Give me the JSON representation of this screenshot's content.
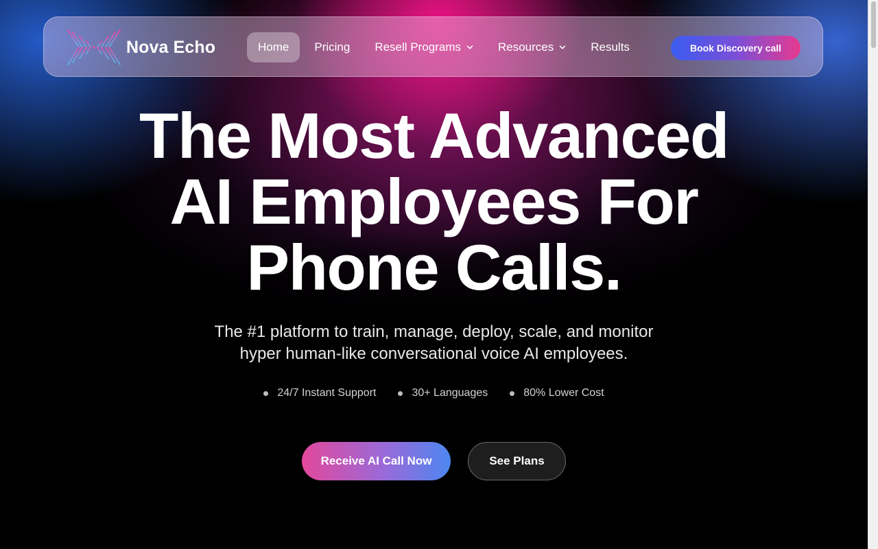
{
  "brand": {
    "name": "Nova Echo",
    "logo_icon": "sound-wave-logo-icon"
  },
  "nav": {
    "items": [
      {
        "label": "Home",
        "active": true,
        "has_dropdown": false
      },
      {
        "label": "Pricing",
        "active": false,
        "has_dropdown": false
      },
      {
        "label": "Resell Programs",
        "active": false,
        "has_dropdown": true
      },
      {
        "label": "Resources",
        "active": false,
        "has_dropdown": true
      },
      {
        "label": "Results",
        "active": false,
        "has_dropdown": false
      }
    ],
    "cta_label": "Book Discovery call"
  },
  "hero": {
    "title_lines": [
      "The Most Advanced",
      "AI Employees For",
      "Phone Calls."
    ],
    "subtitle_lines": [
      "The #1 platform to train, manage, deploy, scale, and monitor",
      "hyper human-like conversational voice AI employees."
    ],
    "features": [
      "24/7 Instant Support",
      "30+ Languages",
      "80% Lower Cost"
    ],
    "primary_button": "Receive AI Call Now",
    "secondary_button": "See Plans"
  },
  "colors": {
    "accent_pink": "#e63a8f",
    "accent_blue": "#3b5cf0",
    "background": "#000000"
  }
}
